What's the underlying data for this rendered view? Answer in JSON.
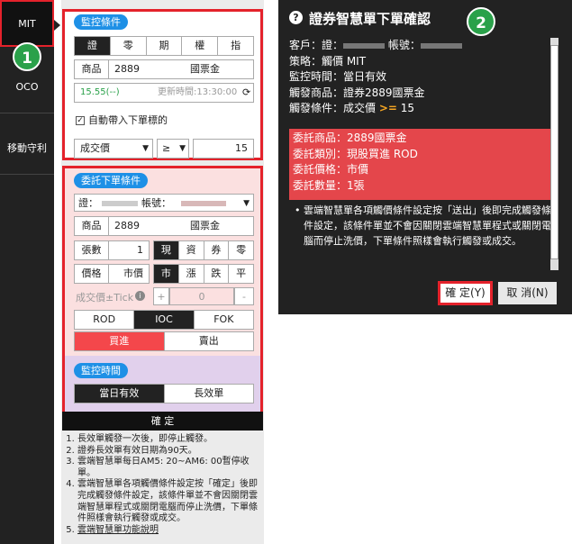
{
  "nav": {
    "items": [
      "MIT",
      "OCO",
      "移動守利"
    ],
    "step1": "1",
    "step2": "2"
  },
  "monitor": {
    "title": "監控條件",
    "tabs": [
      "證",
      "零",
      "期",
      "權",
      "指"
    ],
    "product_label": "商品",
    "product_code": "2889",
    "product_name": "國票金",
    "price": "15.55(--)",
    "update_time": "更新時間:13:30:00",
    "auto_bring_label": "自動帶入下單標的",
    "auto_bring_checked": "✓",
    "condition_field": "成交價",
    "operator": "≥",
    "threshold": "15"
  },
  "order": {
    "title": "委託下單條件",
    "account_prefix": "證：",
    "account_label": "帳號：",
    "product_label": "商品",
    "product_code": "2889",
    "product_name": "國票金",
    "qty_label": "張數",
    "qty_value": "1",
    "type_options": [
      "現",
      "資",
      "券",
      "零"
    ],
    "price_label": "價格",
    "price_value": "市價",
    "price_options": [
      "市",
      "漲",
      "跌",
      "平"
    ],
    "tick_label": "成交價±Tick",
    "tick_plus": "+",
    "tick_value": "0",
    "tick_minus": "-",
    "tif": [
      "ROD",
      "IOC",
      "FOK"
    ],
    "side": [
      "買進",
      "賣出"
    ]
  },
  "watch": {
    "title": "監控時間",
    "options": [
      "當日有效",
      "長效單"
    ]
  },
  "confirm_label": "確 定",
  "notes": [
    "長效單觸發一次後，即停止觸發。",
    "證券長效單有效日期為90天。",
    "雲端智慧單每日AM5: 20~AM6: 00暫停收單。",
    "雲端智慧單各項觸價條件設定按「確定」後即完成觸發條件設定，該條件單並不會因關閉雲端智慧單程式或關閉電腦而停止洗價，下單條件照樣會執行觸發或成交。",
    "雲端智慧單功能說明"
  ],
  "dialog": {
    "help_icon": "?",
    "title": "證券智慧單下單確認",
    "client_label": "客戶：證：",
    "account_label": "帳號：",
    "strategy": "策略：觸價 MIT",
    "monitor_time": "監控時間：當日有效",
    "trigger_product": "觸發商品：證券2889國票金",
    "trigger_cond_prefix": "觸發條件：成交價",
    "trigger_op": ">=",
    "trigger_value": "15",
    "order_product": "委託商品：2889國票金",
    "order_type": "委託類別：現股買進 ROD",
    "order_price": "委託價格：市價",
    "order_qty": "委託數量：1張",
    "note": "雲端智慧單各項觸價條件設定按「送出」後即完成觸發條件設定，該條件單並不會因關閉雲端智慧單程式或關閉電腦而停止洗價，下單條件照樣會執行觸發或成交。",
    "ok": "確 定(Y)",
    "cancel": "取 消(N)"
  },
  "colors": {
    "accent_red": "#e4222b",
    "pill_blue": "#1e90e6",
    "step_green": "#2aa14a",
    "order_bg": "#fbe0e0"
  }
}
